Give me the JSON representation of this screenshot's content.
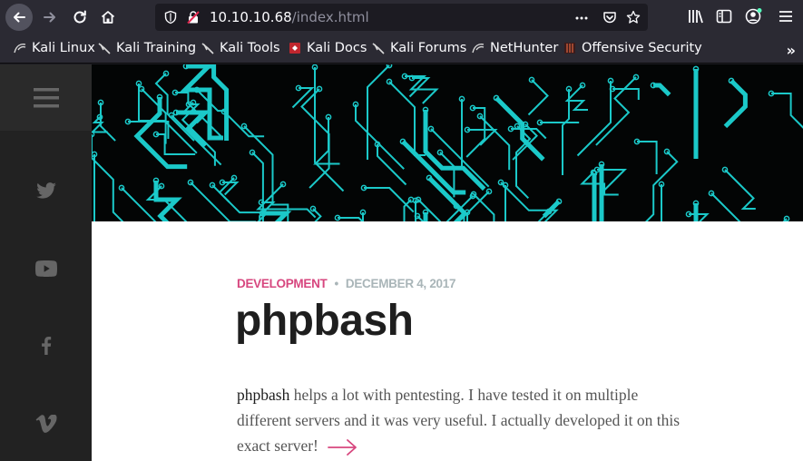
{
  "browser": {
    "url_host": "10.10.10.68",
    "url_path": "/index.html",
    "bookmarks": [
      {
        "label": "Kali Linux",
        "icon": "kali-dragon-icon"
      },
      {
        "label": "Kali Training",
        "icon": "kali-dragon-icon"
      },
      {
        "label": "Kali Tools",
        "icon": "kali-dragon-icon"
      },
      {
        "label": "Kali Docs",
        "icon": "kali-docs-icon"
      },
      {
        "label": "Kali Forums",
        "icon": "kali-dragon-icon"
      },
      {
        "label": "NetHunter",
        "icon": "kali-dragon-icon"
      },
      {
        "label": "Offensive Security",
        "icon": "offsec-icon"
      }
    ],
    "overflow_symbol": "»"
  },
  "sidebar": {
    "social": [
      "twitter-icon",
      "youtube-icon",
      "facebook-icon",
      "vimeo-icon"
    ]
  },
  "post": {
    "category": "DEVELOPMENT",
    "separator": "•",
    "date": "DECEMBER 4, 2017",
    "title": "phpbash",
    "excerpt_lead": "phpbash",
    "excerpt_rest": " helps a lot with pentesting. I have tested it on multiple different servers and it was very useful. I actually developed it on this exact server!"
  },
  "colors": {
    "accent": "#d7477f",
    "circuit": "#1bc9c9",
    "meta_gray": "#a9b5b8"
  }
}
